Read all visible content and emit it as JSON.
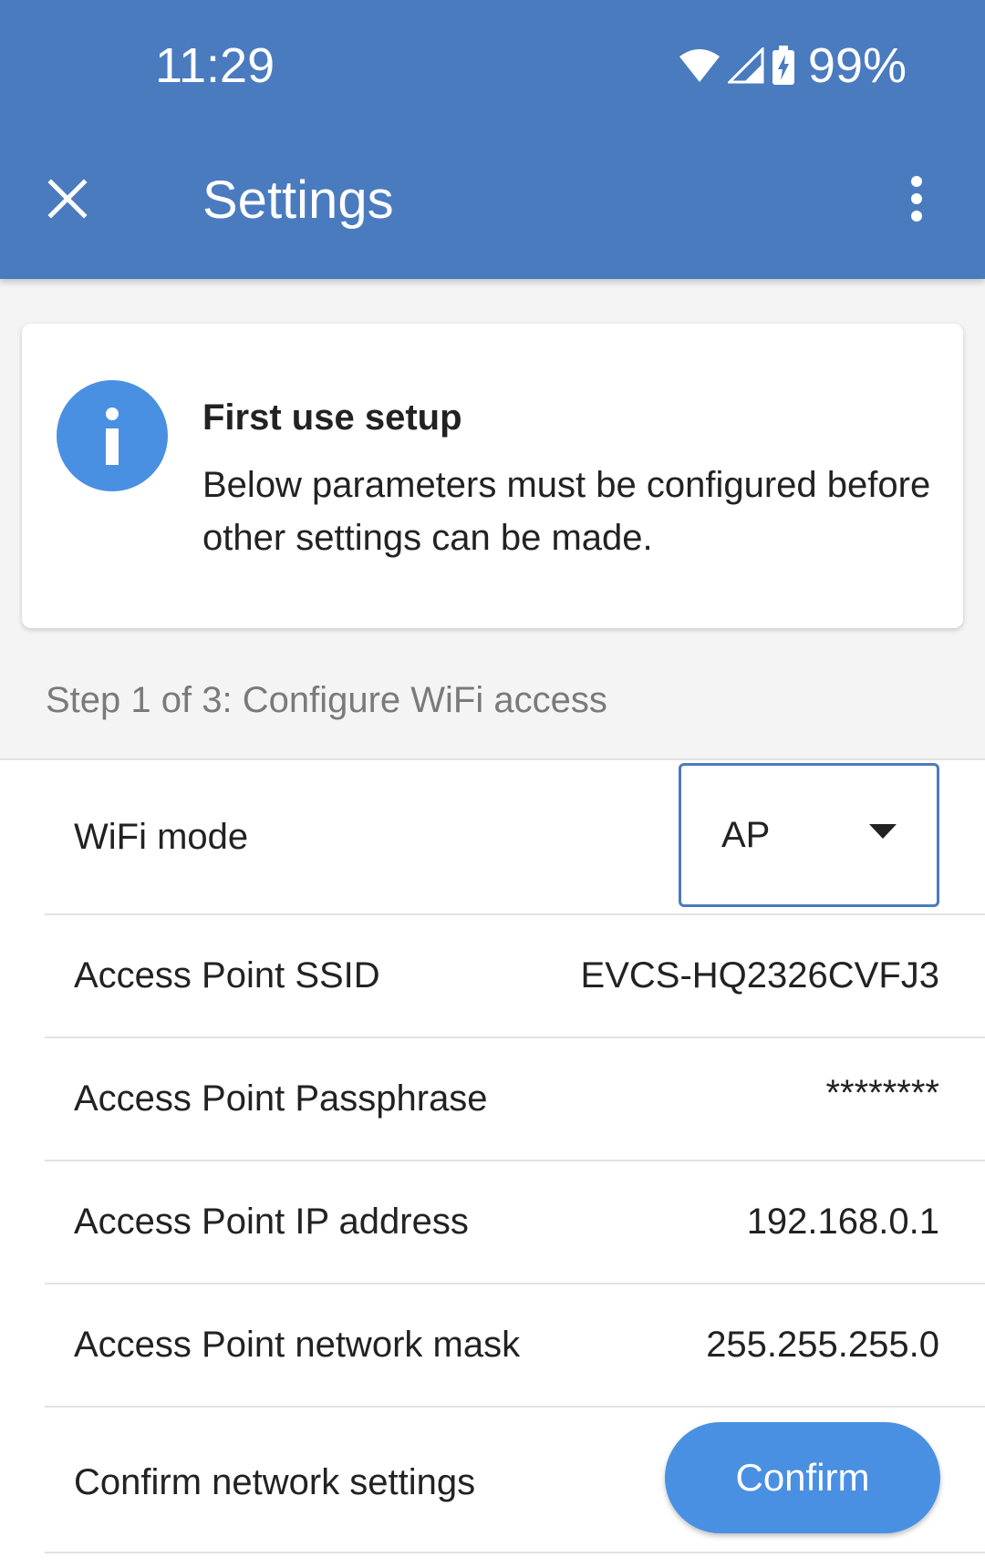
{
  "status_bar": {
    "time": "11:29",
    "battery_percent": "99%",
    "icons": [
      "wifi-icon",
      "cell-signal-icon",
      "battery-charging-icon"
    ]
  },
  "toolbar": {
    "title": "Settings",
    "close_icon": "close-icon",
    "more_icon": "more-vert-icon"
  },
  "info_card": {
    "icon": "info-icon",
    "title": "First use setup",
    "body": "Below parameters must be configured before other settings can be made."
  },
  "step_label": "Step 1 of 3: Configure WiFi access",
  "settings": {
    "wifi_mode": {
      "label": "WiFi mode",
      "value": "AP"
    },
    "ssid": {
      "label": "Access Point SSID",
      "value": "EVCS-HQ2326CVFJ3"
    },
    "passphrase": {
      "label": "Access Point Passphrase",
      "value": "********"
    },
    "ip_address": {
      "label": "Access Point IP address",
      "value": "192.168.0.1"
    },
    "network_mask": {
      "label": "Access Point network mask",
      "value": "255.255.255.0"
    },
    "confirm": {
      "label": "Confirm network settings",
      "button_label": "Confirm"
    }
  },
  "colors": {
    "header": "#4a7bbf",
    "accent": "#4a90e2",
    "background": "#f4f4f4"
  }
}
